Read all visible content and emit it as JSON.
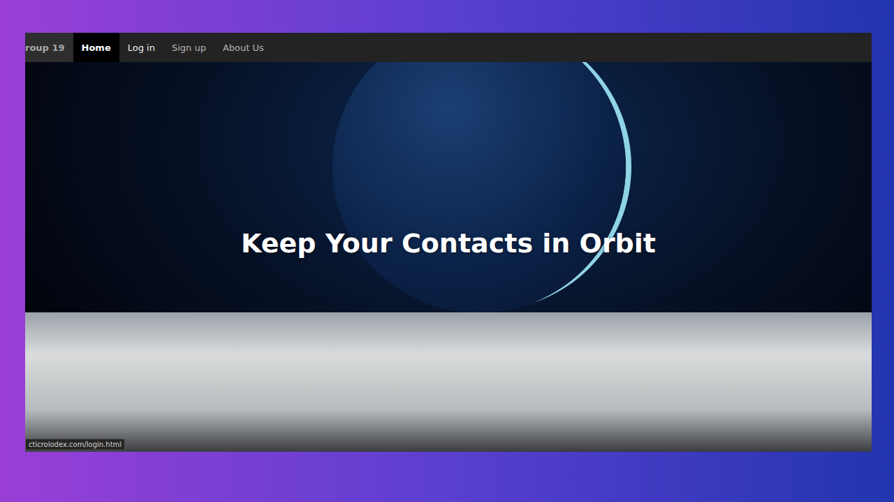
{
  "nav": {
    "brand": "roup 19",
    "items": [
      {
        "label": "Home",
        "selected": true,
        "hovered": false
      },
      {
        "label": "Log in",
        "selected": false,
        "hovered": true
      },
      {
        "label": "Sign up",
        "selected": false,
        "hovered": false
      },
      {
        "label": "About Us",
        "selected": false,
        "hovered": false
      }
    ]
  },
  "hero": {
    "headline": "Keep Your Contacts in Orbit"
  },
  "status_bar": {
    "url": "cticrolodex.com/login.html"
  }
}
